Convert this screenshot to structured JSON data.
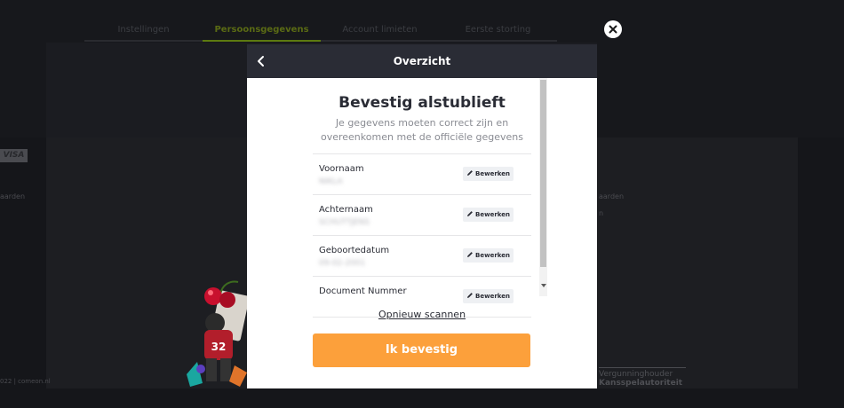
{
  "background": {
    "tabs": [
      "Instellingen",
      "Persoonsgegevens",
      "Account limieten",
      "Eerste storting"
    ],
    "visa_label": "VISA",
    "left_side_text": "aarden",
    "right_side_text_1": "aarden",
    "right_side_text_2": "n",
    "footer_text": "022 | comeon.nl",
    "license_line1": "Vergunninghouder",
    "license_line2": "Kansspelautoriteit"
  },
  "modal": {
    "header_title": "Overzicht",
    "heading": "Bevestig alstublieft",
    "subtitle": "Je gegevens moeten correct zijn en overeenkomen met de officiële gegevens",
    "edit_label": "Bewerken",
    "fields": [
      {
        "label": "Voornaam",
        "value": "NIKLA"
      },
      {
        "label": "Achternaam",
        "value": "SCHUTTJENS"
      },
      {
        "label": "Geboortedatum",
        "value": "09-02-2001"
      },
      {
        "label": "Document Nummer",
        "value": ""
      }
    ],
    "rescan_label": "Opnieuw scannen",
    "confirm_label": "Ik bevestig"
  },
  "close_icon": "close-icon",
  "colors": {
    "accent": "#fca03b",
    "header_bg": "#2a2c35",
    "active_tab": "#5d7a10"
  }
}
